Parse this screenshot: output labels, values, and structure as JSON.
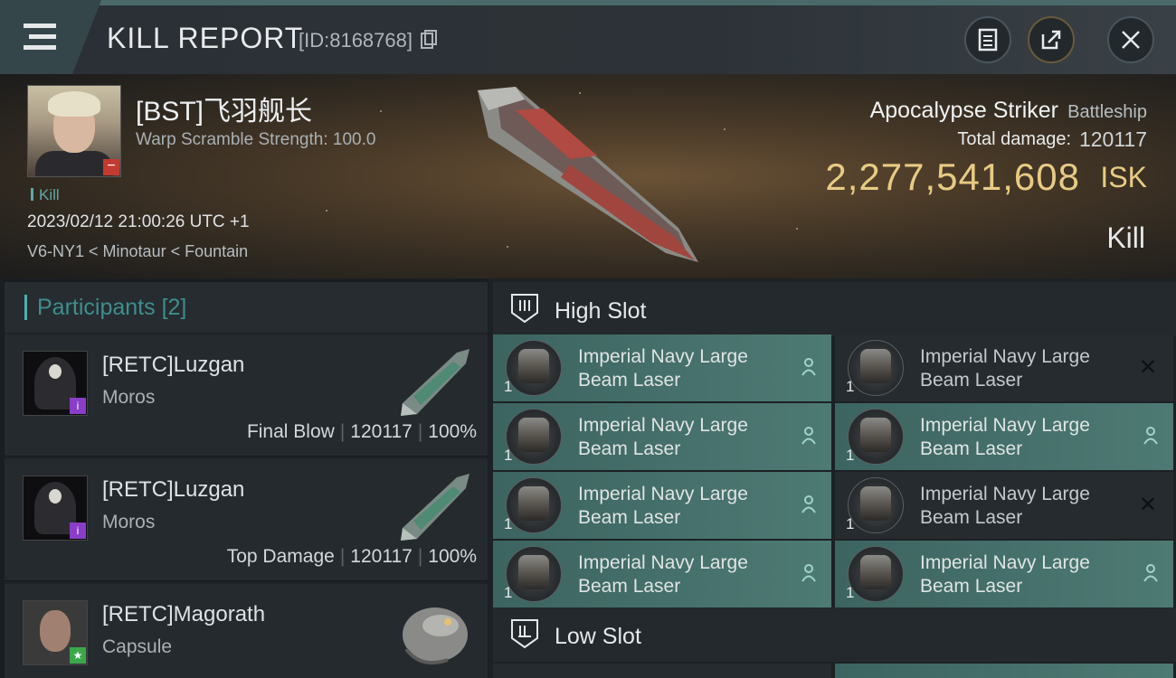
{
  "header": {
    "title": "KILL REPORT",
    "report_id": "[ID:8168768]",
    "copy_icon": "copy-icon",
    "buttons": [
      "clipboard-icon",
      "share-icon",
      "close-icon"
    ]
  },
  "victim": {
    "name": "[BST]飞羽舰长",
    "scramble": "Warp Scramble Strength: 100.0",
    "kill_tag": "Kill",
    "datetime": "2023/02/12 21:00:26 UTC +1",
    "location": "V6-NY1 < Minotaur < Fountain",
    "status_badge": "−"
  },
  "ship": {
    "name": "Apocalypse Striker",
    "class": "Battleship",
    "damage_label": "Total damage:",
    "damage_value": "120117",
    "isk_value": "2,277,541,608",
    "isk_unit": "ISK",
    "result": "Kill"
  },
  "participants": {
    "title": "Participants",
    "count": "[2]",
    "rows": [
      {
        "name": "[RETC]Luzgan",
        "ship": "Moros",
        "role": "Final Blow",
        "damage": "120117",
        "percent": "100%",
        "badge": "i",
        "badge_color": "#8a3ec8"
      },
      {
        "name": "[RETC]Luzgan",
        "ship": "Moros",
        "role": "Top Damage",
        "damage": "120117",
        "percent": "100%",
        "badge": "i",
        "badge_color": "#8a3ec8"
      },
      {
        "name": "[RETC]Magorath",
        "ship": "Capsule",
        "role": "",
        "damage": "",
        "percent": "",
        "badge": "★",
        "badge_color": "#3aa84a"
      }
    ]
  },
  "slots": {
    "high_label": "High Slot",
    "low_label": "Low Slot",
    "high_modules": [
      {
        "name": "Imperial Navy Large Beam Laser",
        "qty": "1",
        "state": "on",
        "icon": "person-icon"
      },
      {
        "name": "Imperial Navy Large Beam Laser",
        "qty": "1",
        "state": "off",
        "icon": "destroyed-x-icon"
      },
      {
        "name": "Imperial Navy Large Beam Laser",
        "qty": "1",
        "state": "on",
        "icon": "person-icon"
      },
      {
        "name": "Imperial Navy Large Beam Laser",
        "qty": "1",
        "state": "on",
        "icon": "person-icon"
      },
      {
        "name": "Imperial Navy Large Beam Laser",
        "qty": "1",
        "state": "on",
        "icon": "person-icon"
      },
      {
        "name": "Imperial Navy Large Beam Laser",
        "qty": "1",
        "state": "off",
        "icon": "destroyed-x-icon"
      },
      {
        "name": "Imperial Navy Large Beam Laser",
        "qty": "1",
        "state": "on",
        "icon": "person-icon"
      },
      {
        "name": "Imperial Navy Large Beam Laser",
        "qty": "1",
        "state": "on",
        "icon": "person-icon"
      }
    ]
  },
  "colors": {
    "accent_teal": "#4fb0b0",
    "isk_gold": "#e8cb84",
    "module_active": "#4e7a74"
  }
}
